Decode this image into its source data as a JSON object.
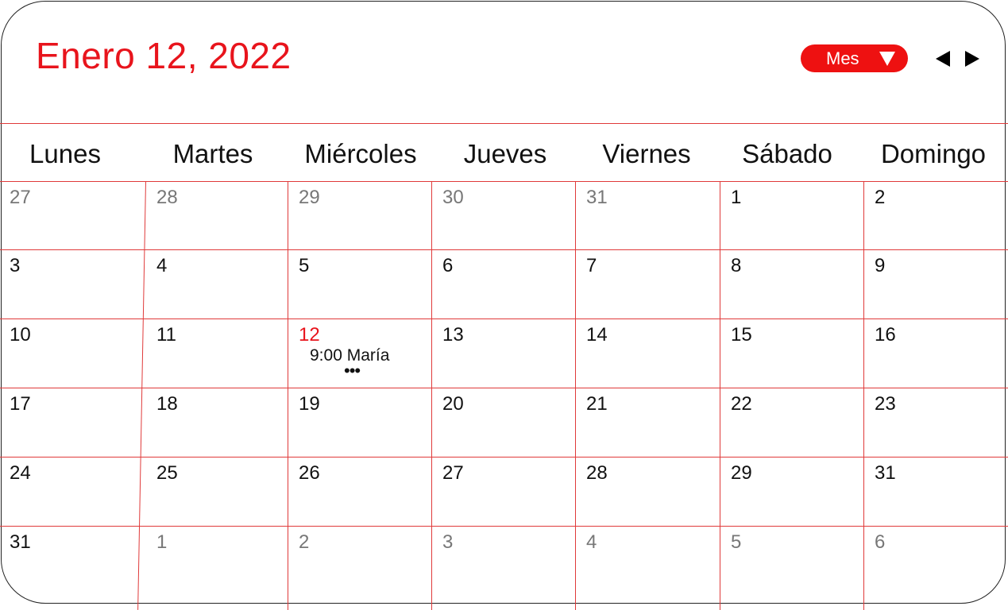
{
  "header": {
    "title": "Enero 12, 2022",
    "view_label": "Mes",
    "prev_icon": "triangle-left",
    "next_icon": "triangle-right"
  },
  "colors": {
    "accent": "#e8141c",
    "grid": "#e03a3a",
    "muted_text": "#777777"
  },
  "weekdays": [
    "Lunes",
    "Martes",
    "Miércoles",
    "Jueves",
    "Viernes",
    "Sábado",
    "Domingo"
  ],
  "weeks": [
    [
      {
        "d": "27",
        "m": true
      },
      {
        "d": "28",
        "m": true
      },
      {
        "d": "29",
        "m": true
      },
      {
        "d": "30",
        "m": true
      },
      {
        "d": "31",
        "m": true
      },
      {
        "d": "1"
      },
      {
        "d": "2"
      }
    ],
    [
      {
        "d": "3"
      },
      {
        "d": "4"
      },
      {
        "d": "5"
      },
      {
        "d": "6"
      },
      {
        "d": "7"
      },
      {
        "d": "8"
      },
      {
        "d": "9"
      }
    ],
    [
      {
        "d": "10"
      },
      {
        "d": "11"
      },
      {
        "d": "12",
        "today": true
      },
      {
        "d": "13"
      },
      {
        "d": "14"
      },
      {
        "d": "15"
      },
      {
        "d": "16"
      }
    ],
    [
      {
        "d": "17"
      },
      {
        "d": "18"
      },
      {
        "d": "19"
      },
      {
        "d": "20"
      },
      {
        "d": "21"
      },
      {
        "d": "22"
      },
      {
        "d": "23"
      }
    ],
    [
      {
        "d": "24"
      },
      {
        "d": "25"
      },
      {
        "d": "26"
      },
      {
        "d": "27"
      },
      {
        "d": "28"
      },
      {
        "d": "29"
      },
      {
        "d": "31"
      }
    ],
    [
      {
        "d": "31"
      },
      {
        "d": "1",
        "m": true
      },
      {
        "d": "2",
        "m": true
      },
      {
        "d": "3",
        "m": true
      },
      {
        "d": "4",
        "m": true
      },
      {
        "d": "5",
        "m": true
      },
      {
        "d": "6",
        "m": true
      }
    ]
  ],
  "event": {
    "text": "9:00 María",
    "more": "•••"
  }
}
